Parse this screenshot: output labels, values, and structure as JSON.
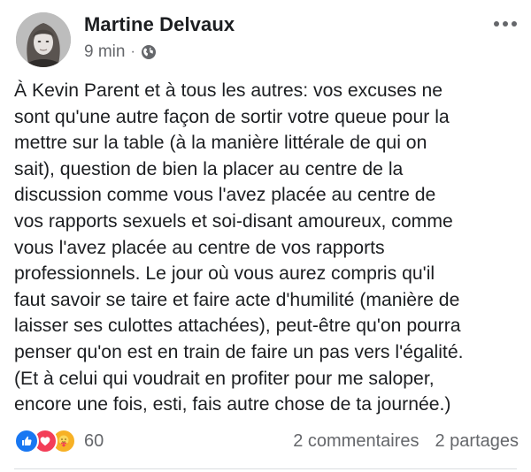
{
  "post": {
    "author": "Martine Delvaux",
    "time": "9 min",
    "separator": "·",
    "privacy_icon": "globe-icon",
    "more_icon": "more-options-icon",
    "lines": [
      "À Kevin Parent et à tous les autres: vos excuses ne",
      "sont qu'une autre façon de sortir votre queue pour la",
      "mettre sur la table (à la manière littérale de qui on",
      "sait), question de bien la placer au centre de la",
      "discussion comme vous l'avez placée au centre de",
      "vos rapports sexuels et soi-disant amoureux, comme",
      "vous l'avez placée au centre de vos rapports",
      "professionnels. Le jour où vous aurez compris qu'il",
      "faut savoir se taire et faire acte d'humilité (manière de",
      "laisser ses culottes attachées), peut-être qu'on pourra",
      "penser qu'on est en train de faire un pas vers l'égalité.",
      "(Et à celui qui voudrait en profiter pour me saloper,",
      "encore une fois, esti, fais autre chose de ta journée.)"
    ]
  },
  "footer": {
    "reaction_icons": [
      "like-icon",
      "love-icon",
      "care-icon"
    ],
    "reaction_count": "60",
    "comments": "2 commentaires",
    "shares": "2 partages"
  },
  "colors": {
    "like": "#1877f2",
    "love": "#f33e58",
    "care": "#f7b125",
    "secondary_text": "#65676b",
    "primary_text": "#1c1e21"
  }
}
